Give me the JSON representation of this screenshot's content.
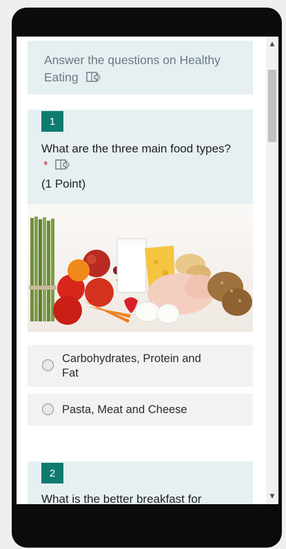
{
  "intro": {
    "text": "Answer the questions on Healthy Eating",
    "reader_icon": "immersive-reader-icon"
  },
  "questions": [
    {
      "number": "1",
      "text": "What are the three main food types?",
      "required_mark": "*",
      "points": "(1 Point)",
      "image": "healthy-food-photo",
      "options": [
        {
          "label": "Carbohydrates, Protein and Fat",
          "selected": false
        },
        {
          "label": "Pasta, Meat and Cheese",
          "selected": false
        }
      ]
    },
    {
      "number": "2",
      "text": "What is the better breakfast for"
    }
  ],
  "colors": {
    "accent": "#0f7b6e",
    "question_bg": "#e6eff2",
    "option_bg": "#f2f2f2",
    "required": "#c4262e"
  }
}
